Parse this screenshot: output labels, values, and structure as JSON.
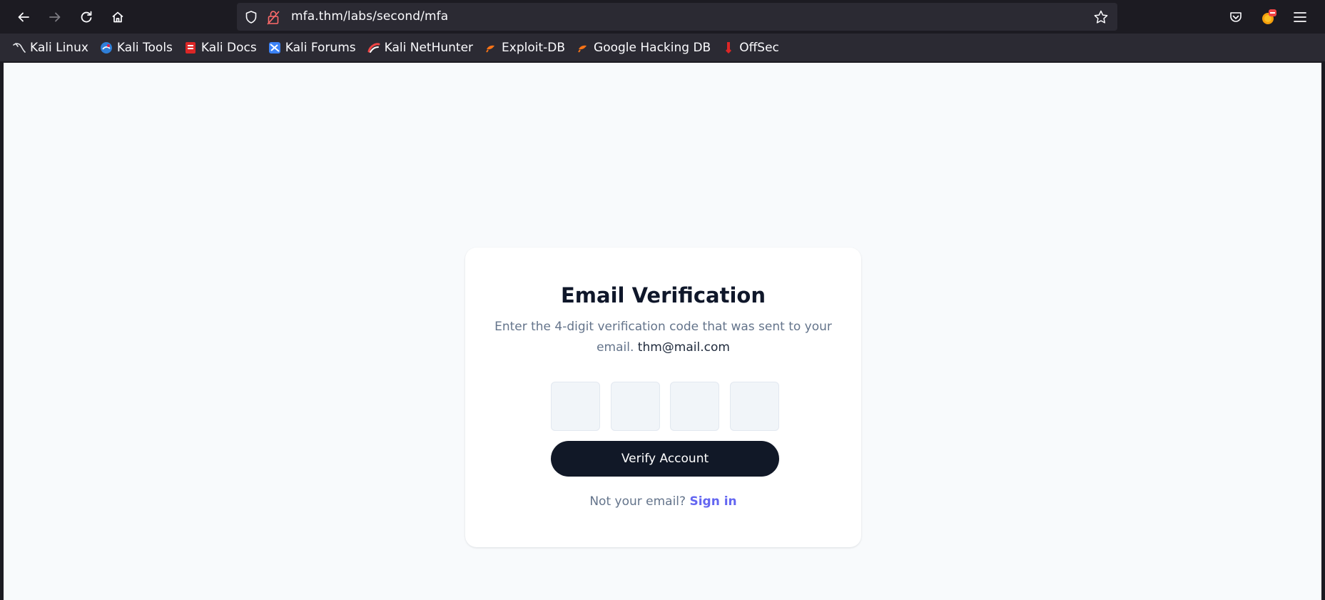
{
  "browser": {
    "url": "mfa.thm/labs/second/mfa",
    "nav": {
      "back_icon": "back-arrow-icon",
      "forward_icon": "forward-arrow-icon",
      "reload_icon": "reload-icon",
      "home_icon": "home-icon"
    },
    "bookmarks": [
      {
        "label": "Kali Linux",
        "icon": "kali-dragon-icon"
      },
      {
        "label": "Kali Tools",
        "icon": "kali-tools-icon"
      },
      {
        "label": "Kali Docs",
        "icon": "kali-docs-icon"
      },
      {
        "label": "Kali Forums",
        "icon": "kali-forums-icon"
      },
      {
        "label": "Kali NetHunter",
        "icon": "kali-nethunter-icon"
      },
      {
        "label": "Exploit-DB",
        "icon": "exploit-db-icon"
      },
      {
        "label": "Google Hacking DB",
        "icon": "ghdb-icon"
      },
      {
        "label": "OffSec",
        "icon": "offsec-icon"
      }
    ]
  },
  "page": {
    "title": "Email Verification",
    "description": "Enter the 4-digit verification code that was sent to your email.",
    "email": "thm@mail.com",
    "otp_boxes": [
      "",
      "",
      "",
      ""
    ],
    "verify_button": "Verify Account",
    "not_your_email": "Not your email?",
    "sign_in_link": "Sign in"
  },
  "colors": {
    "page_bg": "#f8fafc",
    "button_bg": "#111827",
    "link": "#6366f1",
    "muted_text": "#64748b"
  }
}
